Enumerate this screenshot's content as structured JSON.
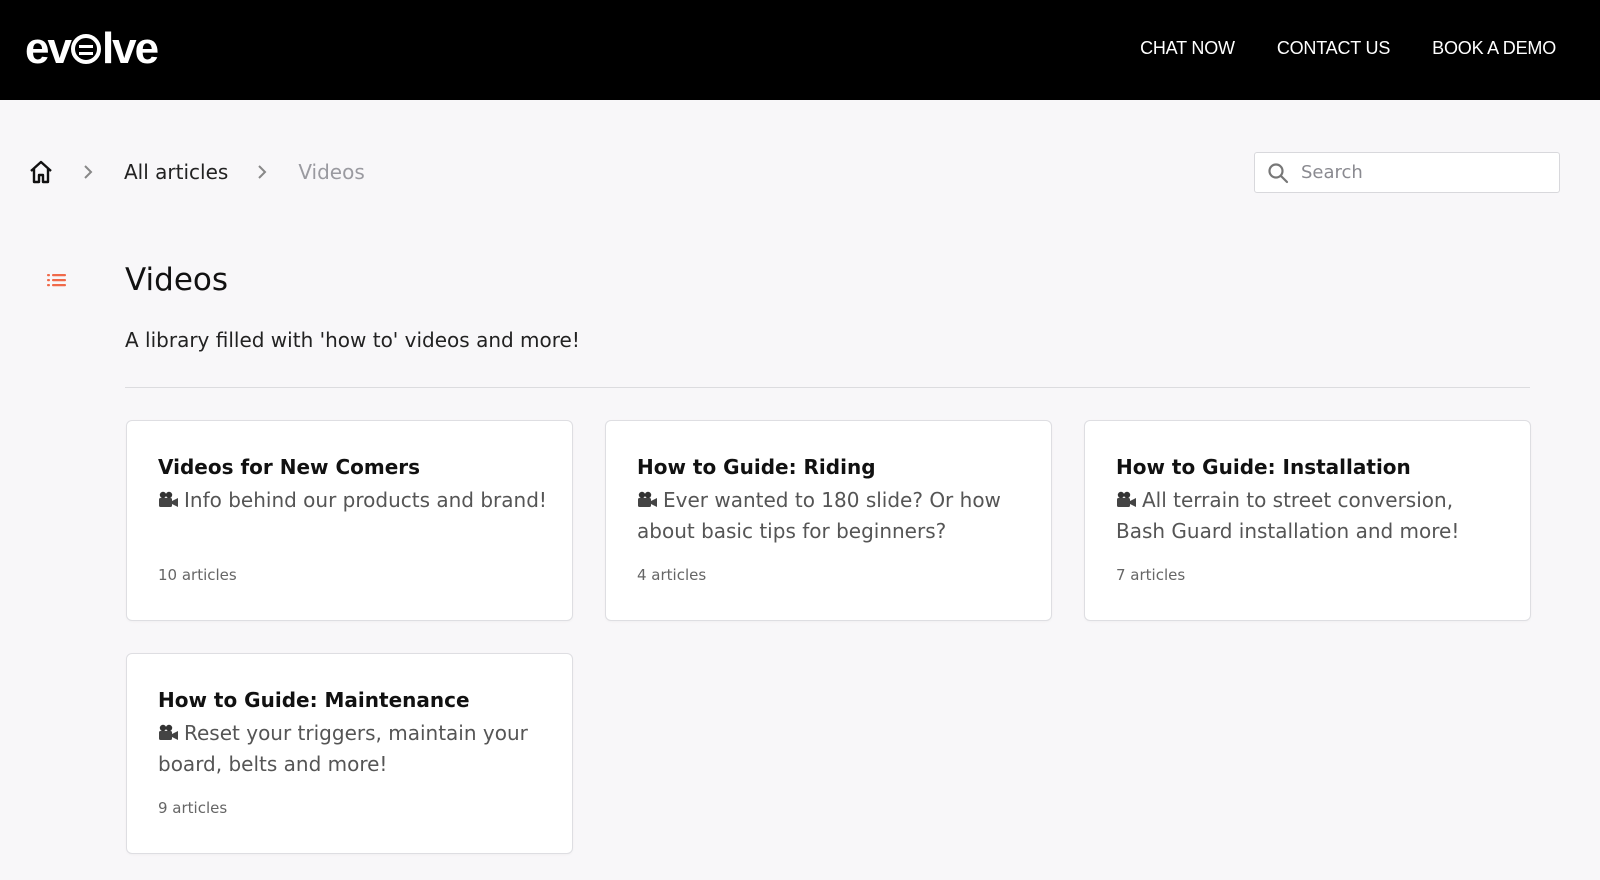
{
  "header": {
    "logo_text": "evolve",
    "nav": [
      {
        "label": "CHAT NOW"
      },
      {
        "label": "CONTACT US"
      },
      {
        "label": "BOOK A DEMO"
      }
    ]
  },
  "breadcrumb": {
    "home_icon": "home-icon",
    "items": [
      {
        "label": "All articles"
      },
      {
        "label": "Videos"
      }
    ]
  },
  "search": {
    "placeholder": "Search",
    "value": "",
    "icon": "search-icon"
  },
  "collection": {
    "icon": "list-icon",
    "title": "Videos",
    "description": "A library filled with 'how to' videos and more!"
  },
  "cards": [
    {
      "title": "Videos for New Comers",
      "icon": "movie-camera-icon",
      "description": "Info behind our products and brand!",
      "count": "10 articles"
    },
    {
      "title": "How to Guide: Riding",
      "icon": "movie-camera-icon",
      "description": "Ever wanted to 180 slide? Or how about basic tips for beginners?",
      "count": "4 articles"
    },
    {
      "title": "How to Guide: Installation",
      "icon": "movie-camera-icon",
      "description": "All terrain to street conversion, Bash Guard installation and more!",
      "count": "7 articles"
    },
    {
      "title": "How to Guide: Maintenance",
      "icon": "movie-camera-icon",
      "description": "Reset your triggers, maintain your board, belts and more!",
      "count": "9 articles"
    }
  ],
  "colors": {
    "header_bg": "#000000",
    "page_bg": "#f8f7f9",
    "accent": "#f06a4a"
  }
}
